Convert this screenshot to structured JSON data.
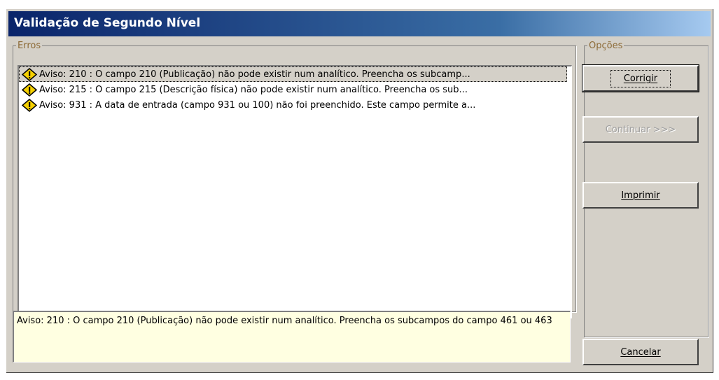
{
  "window": {
    "title": "Validação de Segundo Nível"
  },
  "errors": {
    "legend": "Erros",
    "items": [
      {
        "icon": "warning-icon",
        "text": "Aviso: 210 : O campo 210 (Publicação) não pode existir num analítico. Preencha os subcamp...",
        "selected": true
      },
      {
        "icon": "warning-icon",
        "text": "Aviso: 215 : O campo 215 (Descrição física) não pode existir num analítico. Preencha os sub..."
      },
      {
        "icon": "warning-icon",
        "text": "Aviso: 931 : A data de entrada (campo 931 ou 100) não foi preenchido. Este campo permite a..."
      }
    ]
  },
  "detail": {
    "text": "Aviso: 210 : O campo 210 (Publicação) não pode existir num analítico. Preencha os subcampos do campo 461 ou 463"
  },
  "options": {
    "legend": "Opções",
    "corrigir": "Corrigir",
    "continuar": "Continuar >>>",
    "imprimir": "Imprimir",
    "cancelar": "Cancelar"
  },
  "colors": {
    "title_start": "#0a246a",
    "title_end": "#a6caf0",
    "detail_bg": "#ffffe1",
    "legend": "#8c6a36",
    "warning_fill": "#f5d000"
  }
}
